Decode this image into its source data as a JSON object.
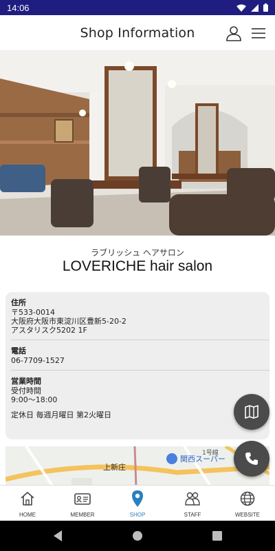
{
  "status": {
    "time": "14:06"
  },
  "header": {
    "title": "Shop Information"
  },
  "shop": {
    "kana": "ラブリッシュ ヘアサロン",
    "name": "LOVERICHE hair salon"
  },
  "info": {
    "address_label": "住所",
    "address_lines": [
      "〒533-0014",
      "大阪府大阪市東淀川区豊新5-20-2",
      "アスタリスク5202 1F"
    ],
    "phone_label": "電話",
    "phone": "06-7709-1527",
    "hours_label": "営業時間",
    "hours_lines": [
      "受付時間",
      "9:00〜18:00"
    ],
    "holiday": "定休日 毎週月曜日 第2火曜日"
  },
  "map": {
    "labels": [
      "上新庄",
      "関西スーパー",
      "1号線"
    ]
  },
  "nav": {
    "items": [
      {
        "label": "HOME",
        "icon": "home-icon"
      },
      {
        "label": "MEMBER",
        "icon": "member-card-icon"
      },
      {
        "label": "SHOP",
        "icon": "map-pin-icon",
        "active": true
      },
      {
        "label": "STAFF",
        "icon": "staff-icon"
      },
      {
        "label": "WEBSITE",
        "icon": "globe-icon"
      }
    ]
  },
  "colors": {
    "status_bar": "#1f1d80",
    "active_nav": "#2a7fc0",
    "fab": "#4b4b4b",
    "card": "#eeeeee"
  }
}
